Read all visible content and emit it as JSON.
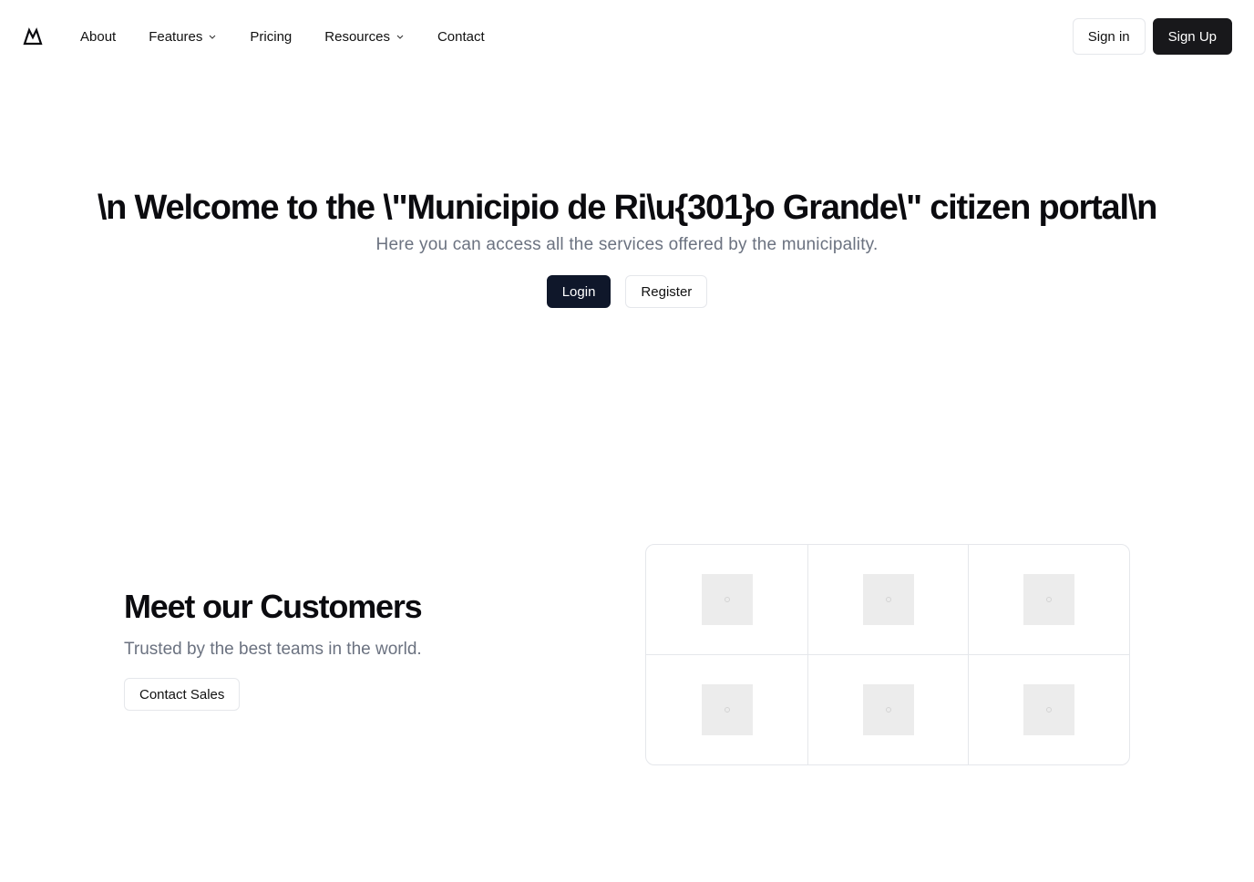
{
  "header": {
    "logo_icon": "mountain-logo-icon",
    "nav": [
      {
        "label": "About",
        "has_dropdown": false
      },
      {
        "label": "Features",
        "has_dropdown": true
      },
      {
        "label": "Pricing",
        "has_dropdown": false
      },
      {
        "label": "Resources",
        "has_dropdown": true
      },
      {
        "label": "Contact",
        "has_dropdown": false
      }
    ],
    "sign_in_label": "Sign in",
    "sign_up_label": "Sign Up"
  },
  "hero": {
    "title": "\\n Welcome to the \\\"Municipio de Ri\\u{301}o Grande\\\" citizen portal\\n",
    "subtitle": "Here you can access all the services offered by the municipality.",
    "login_label": "Login",
    "register_label": "Register"
  },
  "customers": {
    "title": "Meet our Customers",
    "subtitle": "Trusted by the best teams in the world.",
    "contact_label": "Contact Sales",
    "logo_placeholders": 6
  },
  "colors": {
    "primary_dark": "#18181b",
    "login_navy": "#0f172a",
    "muted_text": "#6b7280",
    "border": "#e5e7eb"
  }
}
